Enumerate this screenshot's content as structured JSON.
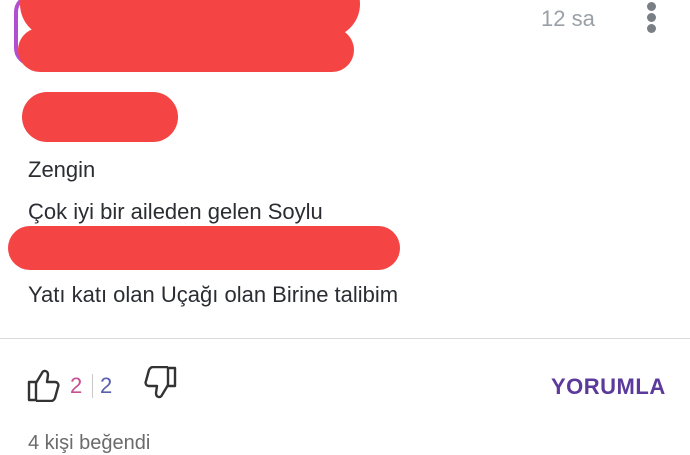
{
  "comment": {
    "timestamp": "12 sa",
    "lines": [
      "Zengin",
      "Çok iyi bir aileden gelen Soylu",
      "Yatı katı olan Uçağı olan Birine talibim"
    ]
  },
  "reactions": {
    "likes": "2",
    "dislikes": "2"
  },
  "actions": {
    "reply_label": "YORUMLA"
  },
  "footer": {
    "partial_text": "4 kişi beğendi"
  },
  "icons": {
    "more": "more-vertical-icon",
    "like": "thumbs-up-icon",
    "dislike": "thumbs-down-icon"
  },
  "colors": {
    "accent": "#5b3a9c",
    "like_count": "#c84f93",
    "dislike_count": "#5a5fae",
    "redaction": "#f44444"
  }
}
